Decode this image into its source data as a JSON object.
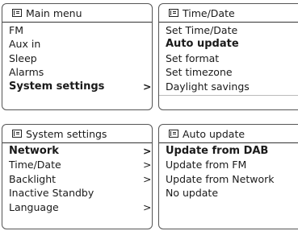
{
  "screens": [
    {
      "title": "Main menu",
      "items": [
        {
          "label": "FM",
          "bold": false,
          "arrow": ""
        },
        {
          "label": "Aux in",
          "bold": false,
          "arrow": ""
        },
        {
          "label": "Sleep",
          "bold": false,
          "arrow": ""
        },
        {
          "label": "Alarms",
          "bold": false,
          "arrow": ""
        },
        {
          "label": "System settings",
          "bold": true,
          "arrow": ">"
        }
      ]
    },
    {
      "title": "Time/Date",
      "items": [
        {
          "label": "Set Time/Date",
          "bold": false,
          "arrow": ""
        },
        {
          "label": "Auto update",
          "bold": true,
          "arrow": ">"
        },
        {
          "label": "Set format",
          "bold": false,
          "arrow": ""
        },
        {
          "label": "Set timezone",
          "bold": false,
          "arrow": ">"
        },
        {
          "label": "Daylight savings",
          "bold": false,
          "arrow": ""
        }
      ]
    },
    {
      "title": "System settings",
      "items": [
        {
          "label": "Network",
          "bold": true,
          "arrow": ">"
        },
        {
          "label": "Time/Date",
          "bold": false,
          "arrow": ">"
        },
        {
          "label": "Backlight",
          "bold": false,
          "arrow": ">"
        },
        {
          "label": "Inactive Standby",
          "bold": false,
          "arrow": ""
        },
        {
          "label": "Language",
          "bold": false,
          "arrow": ">"
        }
      ]
    },
    {
      "title": "Auto update",
      "items": [
        {
          "label": "Update from DAB",
          "bold": true,
          "arrow": "*"
        },
        {
          "label": "Update from FM",
          "bold": false,
          "arrow": ""
        },
        {
          "label": "Update from Network",
          "bold": false,
          "arrow": ""
        },
        {
          "label": "No update",
          "bold": false,
          "arrow": ""
        }
      ]
    }
  ]
}
